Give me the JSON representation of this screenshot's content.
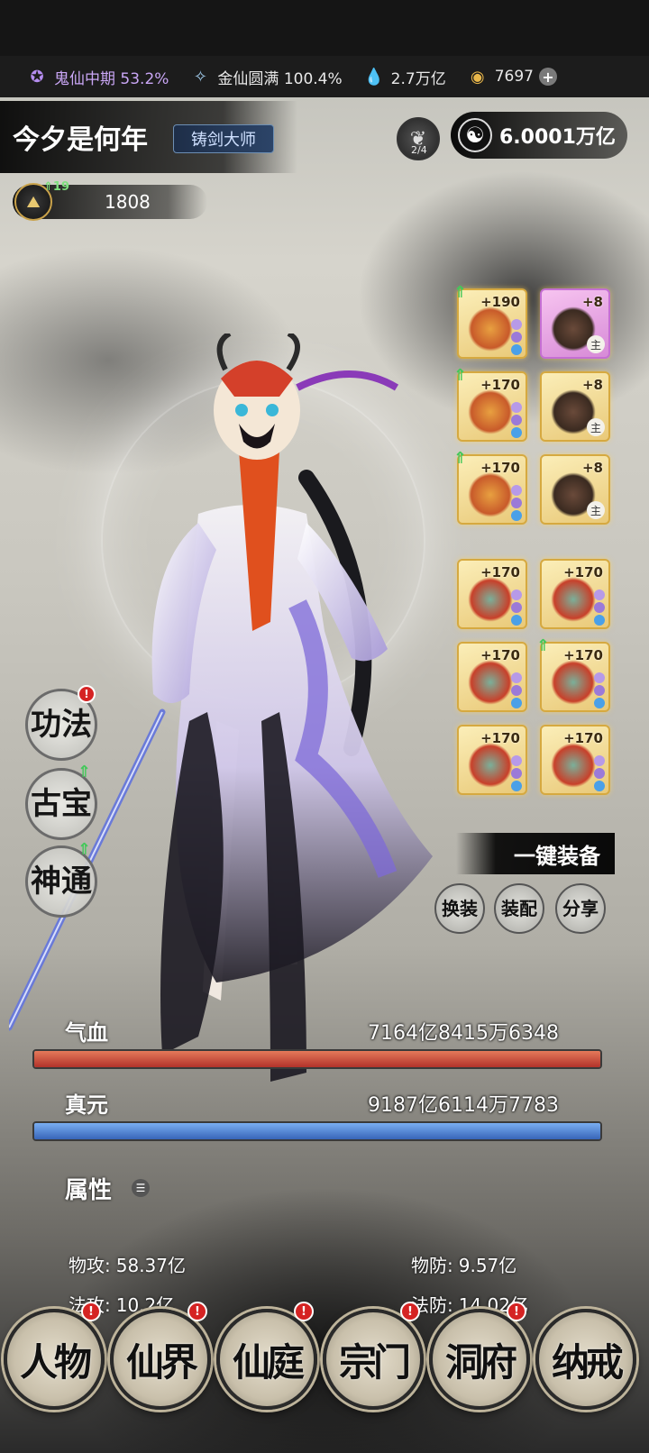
{
  "resources": {
    "realm_ghost": "鬼仙中期 53.2%",
    "realm_gold": "金仙圆满 100.4%",
    "spirit_stone": "2.7万亿",
    "coins": "7697"
  },
  "player": {
    "name": "今夕是何年",
    "title": "铸剑大师",
    "slot_count": "2/4",
    "power": "6.0001万亿",
    "level_up": "19",
    "level": "1808"
  },
  "equipment": {
    "left": [
      {
        "level": "+190",
        "up": true
      },
      {
        "level": "+170",
        "up": true
      },
      {
        "level": "+170",
        "up": true
      },
      {
        "level": "+170",
        "up": false
      },
      {
        "level": "+170",
        "up": false
      },
      {
        "level": "+170",
        "up": false
      }
    ],
    "right": [
      {
        "level": "+8",
        "main": "主",
        "pink": true
      },
      {
        "level": "+8",
        "main": "主"
      },
      {
        "level": "+8",
        "main": "主"
      },
      {
        "level": "+170",
        "up": false
      },
      {
        "level": "+170",
        "up": true
      },
      {
        "level": "+170",
        "up": false
      }
    ]
  },
  "skills": {
    "gongfa": "功法",
    "gubao": "古宝",
    "shentong": "神通",
    "red_dot": "!",
    "green_up": "⇑"
  },
  "actions": {
    "equip_all": "一键装备",
    "swap": "换装",
    "assemble": "装配",
    "share": "分享"
  },
  "stats": {
    "hp_label": "气血",
    "hp_value": "7164亿8415万6348",
    "hp_fill": 1.0,
    "mp_label": "真元",
    "mp_value": "9187亿6114万7783",
    "mp_fill": 1.0
  },
  "attributes": {
    "title": "属性",
    "items": [
      {
        "k": "物攻:",
        "v": "58.37亿"
      },
      {
        "k": "物防:",
        "v": "9.57亿"
      },
      {
        "k": "法攻:",
        "v": "10.2亿"
      },
      {
        "k": "法防:",
        "v": "14.02亿"
      }
    ]
  },
  "nav": {
    "items": [
      "人物",
      "仙界",
      "仙庭",
      "宗门",
      "洞府",
      "纳戒"
    ],
    "red_dot": "!"
  },
  "colors": {
    "hp": "#c0402e",
    "mp": "#4a7fd0",
    "gear_gold": "#e9c978",
    "gear_pink": "#d78ad7"
  }
}
